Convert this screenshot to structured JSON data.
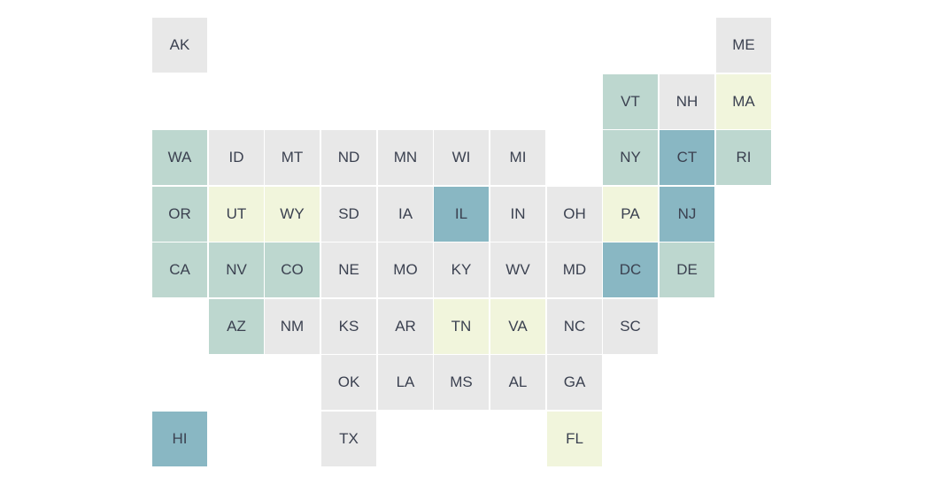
{
  "map": {
    "type": "tile-grid-map",
    "category_colors": {
      "none": "#e8e8e8",
      "low": "#f1f5dc",
      "mid": "#bdd7cf",
      "high": "#89b7c3"
    },
    "states": [
      {
        "abbr": "AK",
        "row": 0,
        "col": 0,
        "category": "none"
      },
      {
        "abbr": "ME",
        "row": 0,
        "col": 10,
        "category": "none"
      },
      {
        "abbr": "VT",
        "row": 1,
        "col": 8,
        "category": "mid"
      },
      {
        "abbr": "NH",
        "row": 1,
        "col": 9,
        "category": "none"
      },
      {
        "abbr": "MA",
        "row": 1,
        "col": 10,
        "category": "low"
      },
      {
        "abbr": "WA",
        "row": 2,
        "col": 0,
        "category": "mid"
      },
      {
        "abbr": "ID",
        "row": 2,
        "col": 1,
        "category": "none"
      },
      {
        "abbr": "MT",
        "row": 2,
        "col": 2,
        "category": "none"
      },
      {
        "abbr": "ND",
        "row": 2,
        "col": 3,
        "category": "none"
      },
      {
        "abbr": "MN",
        "row": 2,
        "col": 4,
        "category": "none"
      },
      {
        "abbr": "WI",
        "row": 2,
        "col": 5,
        "category": "none"
      },
      {
        "abbr": "MI",
        "row": 2,
        "col": 6,
        "category": "none"
      },
      {
        "abbr": "NY",
        "row": 2,
        "col": 8,
        "category": "mid"
      },
      {
        "abbr": "CT",
        "row": 2,
        "col": 9,
        "category": "high"
      },
      {
        "abbr": "RI",
        "row": 2,
        "col": 10,
        "category": "mid"
      },
      {
        "abbr": "OR",
        "row": 3,
        "col": 0,
        "category": "mid"
      },
      {
        "abbr": "UT",
        "row": 3,
        "col": 1,
        "category": "low"
      },
      {
        "abbr": "WY",
        "row": 3,
        "col": 2,
        "category": "low"
      },
      {
        "abbr": "SD",
        "row": 3,
        "col": 3,
        "category": "none"
      },
      {
        "abbr": "IA",
        "row": 3,
        "col": 4,
        "category": "none"
      },
      {
        "abbr": "IL",
        "row": 3,
        "col": 5,
        "category": "high"
      },
      {
        "abbr": "IN",
        "row": 3,
        "col": 6,
        "category": "none"
      },
      {
        "abbr": "OH",
        "row": 3,
        "col": 7,
        "category": "none"
      },
      {
        "abbr": "PA",
        "row": 3,
        "col": 8,
        "category": "low"
      },
      {
        "abbr": "NJ",
        "row": 3,
        "col": 9,
        "category": "high"
      },
      {
        "abbr": "CA",
        "row": 4,
        "col": 0,
        "category": "mid"
      },
      {
        "abbr": "NV",
        "row": 4,
        "col": 1,
        "category": "mid"
      },
      {
        "abbr": "CO",
        "row": 4,
        "col": 2,
        "category": "mid"
      },
      {
        "abbr": "NE",
        "row": 4,
        "col": 3,
        "category": "none"
      },
      {
        "abbr": "MO",
        "row": 4,
        "col": 4,
        "category": "none"
      },
      {
        "abbr": "KY",
        "row": 4,
        "col": 5,
        "category": "none"
      },
      {
        "abbr": "WV",
        "row": 4,
        "col": 6,
        "category": "none"
      },
      {
        "abbr": "MD",
        "row": 4,
        "col": 7,
        "category": "none"
      },
      {
        "abbr": "DC",
        "row": 4,
        "col": 8,
        "category": "high"
      },
      {
        "abbr": "DE",
        "row": 4,
        "col": 9,
        "category": "mid"
      },
      {
        "abbr": "AZ",
        "row": 5,
        "col": 1,
        "category": "mid"
      },
      {
        "abbr": "NM",
        "row": 5,
        "col": 2,
        "category": "none"
      },
      {
        "abbr": "KS",
        "row": 5,
        "col": 3,
        "category": "none"
      },
      {
        "abbr": "AR",
        "row": 5,
        "col": 4,
        "category": "none"
      },
      {
        "abbr": "TN",
        "row": 5,
        "col": 5,
        "category": "low"
      },
      {
        "abbr": "VA",
        "row": 5,
        "col": 6,
        "category": "low"
      },
      {
        "abbr": "NC",
        "row": 5,
        "col": 7,
        "category": "none"
      },
      {
        "abbr": "SC",
        "row": 5,
        "col": 8,
        "category": "none"
      },
      {
        "abbr": "OK",
        "row": 6,
        "col": 3,
        "category": "none"
      },
      {
        "abbr": "LA",
        "row": 6,
        "col": 4,
        "category": "none"
      },
      {
        "abbr": "MS",
        "row": 6,
        "col": 5,
        "category": "none"
      },
      {
        "abbr": "AL",
        "row": 6,
        "col": 6,
        "category": "none"
      },
      {
        "abbr": "GA",
        "row": 6,
        "col": 7,
        "category": "none"
      },
      {
        "abbr": "HI",
        "row": 7,
        "col": 0,
        "category": "high"
      },
      {
        "abbr": "TX",
        "row": 7,
        "col": 3,
        "category": "none"
      },
      {
        "abbr": "FL",
        "row": 7,
        "col": 7,
        "category": "low"
      }
    ]
  }
}
